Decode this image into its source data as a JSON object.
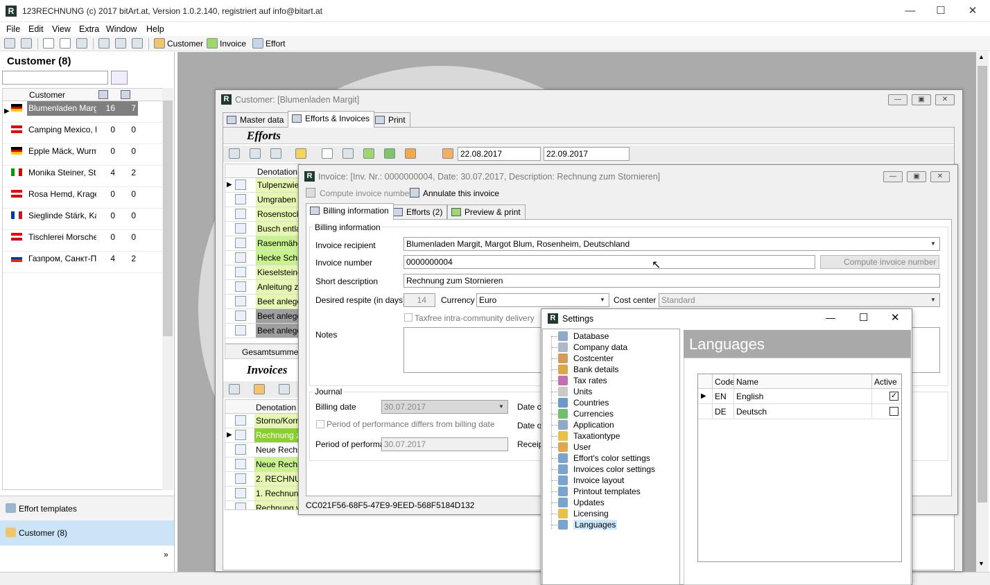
{
  "app": {
    "title": "123RECHNUNG (c) 2017 bitArt.at, Version 1.0.2.140, registriert auf info@bitart.at",
    "logo_letter": "R"
  },
  "menu": [
    "File",
    "Edit",
    "View",
    "Extra",
    "Window",
    "Help"
  ],
  "toolbar": {
    "customer": "Customer",
    "invoice": "Invoice",
    "effort": "Effort"
  },
  "left": {
    "title": "Customer (8)",
    "columns": {
      "customer": "Customer"
    },
    "rows": [
      {
        "flag": "de",
        "name": "Blumenladen Margit",
        "a": "16",
        "b": "7",
        "selected": true
      },
      {
        "flag": "at",
        "name": "Camping Mexico, Br",
        "a": "0",
        "b": "0"
      },
      {
        "flag": "de",
        "name": "Epple Mäck, Wurmd",
        "a": "0",
        "b": "0"
      },
      {
        "flag": "it",
        "name": "Monika Steiner, Stei",
        "a": "4",
        "b": "2"
      },
      {
        "flag": "at",
        "name": "Rosa Hemd, Kragen",
        "a": "0",
        "b": "0"
      },
      {
        "flag": "fr",
        "name": "Sieglinde Stärk, Kar",
        "a": "0",
        "b": "0"
      },
      {
        "flag": "at",
        "name": "Tischlerei Morscher,",
        "a": "0",
        "b": "0"
      },
      {
        "flag": "ru",
        "name": "Газпром, Санкт-Пе",
        "a": "4",
        "b": "2"
      }
    ],
    "nav": {
      "templates": "Effort templates",
      "customer": "Customer (8)"
    }
  },
  "customer_win": {
    "title": "Customer: [Blumenladen Margit]",
    "tabs": [
      "Master data",
      "Efforts & Invoices",
      "Print"
    ],
    "efforts_heading": "Efforts",
    "date_from": "22.08.2017",
    "date_to": "22.09.2017",
    "efforts_col": "Denotation",
    "efforts": [
      {
        "t": "Tulpenzwieb",
        "c": "green2"
      },
      {
        "t": "Umgraben",
        "c": "green2"
      },
      {
        "t": "Rosenstock",
        "c": "green2"
      },
      {
        "t": "Busch entlau",
        "c": "green2"
      },
      {
        "t": "Rasenmähen",
        "c": "green1"
      },
      {
        "t": "Hecke Schne",
        "c": "green1"
      },
      {
        "t": "Kieselsteine",
        "c": "green2"
      },
      {
        "t": "Anleitung zu",
        "c": "green2"
      },
      {
        "t": "Beet anlege",
        "c": "green2"
      },
      {
        "t": "Beet anlege",
        "c": "gray"
      },
      {
        "t": "Beet anlege",
        "c": "gray"
      }
    ],
    "sum_label": "Gesamtsumme Ne",
    "invoices_heading": "Invoices",
    "invoices": [
      {
        "t": "Storno/Korre",
        "c": "green2"
      },
      {
        "t": "Rechnung zu",
        "c": "sel"
      },
      {
        "t": "Neue Rechnu",
        "c": "white"
      },
      {
        "t": "Neue Rechnu",
        "c": "green1"
      },
      {
        "t": "2. RECHNUN",
        "c": "green2"
      },
      {
        "t": "1. Rechnung",
        "c": "green2"
      },
      {
        "t": "Rechnung vo",
        "c": "green2"
      }
    ]
  },
  "invoice_win": {
    "title": "Invoice: [Inv. Nr.: 0000000004, Date: 30.07.2017, Description: Rechnung zum Stornieren]",
    "compute": "Compute invoice number",
    "annulate": "Annulate this invoice",
    "tabs": [
      "Billing information",
      "Efforts (2)",
      "Preview & print"
    ],
    "group": "Billing information",
    "recipient_label": "Invoice recipient",
    "recipient": "Blumenladen Margit, Margot Blum, Rosenheim, Deutschland",
    "number_label": "Invoice number",
    "number": "0000000004",
    "compute_btn": "Compute invoice number",
    "short_label": "Short description",
    "short": "Rechnung zum Stornieren",
    "respite_label": "Desired respite (in days)",
    "respite": "14",
    "currency_label": "Currency",
    "currency": "Euro",
    "costcenter_label": "Cost center",
    "costcenter": "Standard",
    "taxfree": "Taxfree intra-community delivery",
    "notes_label": "Notes",
    "journal": "Journal",
    "billing_date_label": "Billing date",
    "billing_date": "30.07.2017",
    "period_differs": "Period of performance differs from billing date",
    "period_label": "Period of performar",
    "period": "30.07.2017",
    "date_cr": "Date cr",
    "date_o": "Date o",
    "receipt": "Receipt",
    "guid": "CC021F56-68F5-47E9-9EED-568F5184D132"
  },
  "settings": {
    "title": "Settings",
    "tree": [
      "Database",
      "Company data",
      "Costcenter",
      "Bank details",
      "Tax rates",
      "Units",
      "Countries",
      "Currencies",
      "Application",
      "Taxationtype",
      "User",
      "Effort's color settings",
      "Invoices color settings",
      "Invoice layout",
      "Printout templates",
      "Updates",
      "Licensing",
      "Languages"
    ],
    "selected": "Languages",
    "heading": "Languages",
    "cols": {
      "code": "Code",
      "name": "Name",
      "active": "Active"
    },
    "langs": [
      {
        "code": "EN",
        "name": "English",
        "active": true
      },
      {
        "code": "DE",
        "name": "Deutsch",
        "active": false
      }
    ]
  }
}
